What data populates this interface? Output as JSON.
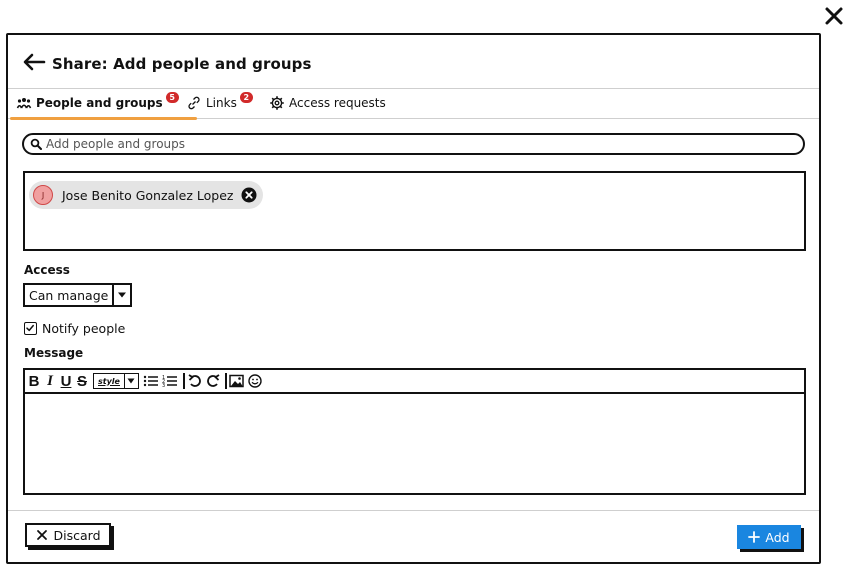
{
  "dialog": {
    "title": "Share: Add people and groups"
  },
  "tabs": [
    {
      "label": "People and groups",
      "badge": "5",
      "icon": "people-icon"
    },
    {
      "label": "Links",
      "badge": "2",
      "icon": "link-icon"
    },
    {
      "label": "Access requests",
      "icon": "gear-icon"
    }
  ],
  "search": {
    "placeholder": "Add people and groups",
    "value": ""
  },
  "selected_people": [
    {
      "initial": "J",
      "name": "Jose Benito Gonzalez Lopez"
    }
  ],
  "access": {
    "label": "Access",
    "selected": "Can manage"
  },
  "notify": {
    "label": "Notify people",
    "checked": true
  },
  "message": {
    "label": "Message",
    "value": "",
    "toolbar": {
      "bold": "B",
      "italic": "I",
      "underline": "U",
      "strike": "S",
      "style": "style"
    }
  },
  "buttons": {
    "discard": "Discard",
    "add": "Add"
  },
  "colors": {
    "accent": "#1a86e0",
    "badge": "#d12a2a",
    "active_tab": "#f0a040",
    "avatar": "#f0a0a0"
  }
}
